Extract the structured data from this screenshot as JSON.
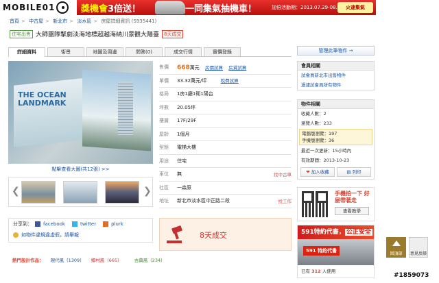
{
  "banner": {
    "logo": "MOBILE01",
    "lottery": "獎機會",
    "times": "3倍送！",
    "slogan": "一同集氣抽機車！",
    "period": "加倍活動期：2013.07.29-08.04",
    "cta": "火速集氣"
  },
  "breadcrumb": [
    "首頁",
    "中古屋",
    "新北市",
    "淡水區",
    "房屋詳細資訊 (S935441)"
  ],
  "title": {
    "tag": "住宅出售",
    "text": "大師團隊擊劇淡海地標超越海納川景觀大陽臺",
    "badge": "8天成交"
  },
  "tabs": [
    "詳細資料",
    "街景",
    "地圖及周邊",
    "問答(0)",
    "成交行情",
    "實價登錄"
  ],
  "photo": {
    "line1": "THE OCEAN",
    "line2": "LANDMARK"
  },
  "more_pics": "點擊查看大圖(共12張) >>",
  "share": {
    "label": "分享到：",
    "facebook": "facebook",
    "twitter": "twitter",
    "plurk": "plurk",
    "report": "如物件違規違虛假，請舉報"
  },
  "categories": {
    "label": "熱門設計作品：",
    "a": "現代風（1309）",
    "b": "鄉村風（665）",
    "c": "古典風（234）"
  },
  "info": {
    "price_k": "售價",
    "price": "668",
    "price_unit": "萬元",
    "link1": "房價試算",
    "link2": "房貸試算",
    "unit_k": "單價",
    "unit": "33.32萬元/坪",
    "link3": "稅費試算",
    "layout_k": "格局",
    "layout": "1房1廳1衛1陽台",
    "area_k": "坪數",
    "area": "20.05坪",
    "floor_k": "樓層",
    "floor": "17F/29F",
    "age_k": "屋齡",
    "age": "1個月",
    "type_k": "型態",
    "type": "電梯大樓",
    "use_k": "用途",
    "use": "住宅",
    "park_k": "車位",
    "park": "無",
    "park_link": "找中古車",
    "comm_k": "社區",
    "comm": "一森原",
    "addr_k": "地址",
    "addr": "新北市淡水區中正路二段",
    "addr_link": "找工作"
  },
  "sold": "8天成交",
  "right": {
    "manage": "管理此筆物件 →",
    "member_title": "會員相關",
    "member1": "試會員新北市出售物件",
    "member2": "過濾試會員所有物件",
    "stats_title": "物件相關",
    "favs": "收藏人數：2",
    "views": "瀏覽人數：233",
    "pc_views": "電腦版瀏覽：197",
    "mobile_views": "手機版瀏覽：36",
    "updated": "最近一次更新：15小時內",
    "expires": "有效期間：2013-10-23",
    "add_fav": "加入收藏",
    "print": "列印",
    "qr_text": "手機拍一下 好屋帶著走",
    "qr_btn": "查看教學",
    "ad_title": "591特約代書",
    "ad_sub": "公正安全",
    "ad_foot_pre": "已有",
    "ad_foot_num": "312",
    "ad_foot_post": "人使用"
  },
  "float": {
    "back": "回頂部",
    "feedback": "意見反饋"
  },
  "listing_id": "#1859073"
}
